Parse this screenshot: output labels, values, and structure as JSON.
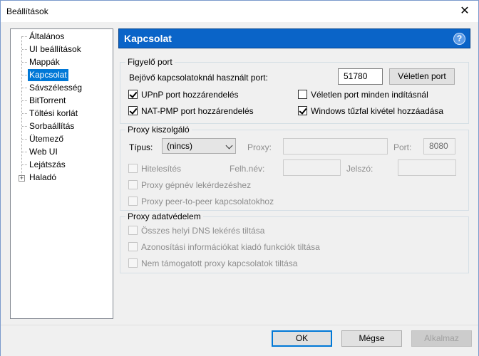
{
  "window": {
    "title": "Beállítások",
    "close_glyph": "✕"
  },
  "sidebar": {
    "items": [
      {
        "label": "Általános"
      },
      {
        "label": "UI beállítások"
      },
      {
        "label": "Mappák"
      },
      {
        "label": "Kapcsolat",
        "selected": true
      },
      {
        "label": "Sávszélesség"
      },
      {
        "label": "BitTorrent"
      },
      {
        "label": "Töltési korlát"
      },
      {
        "label": "Sorbaállítás"
      },
      {
        "label": "Ütemező"
      },
      {
        "label": "Web UI"
      },
      {
        "label": "Lejátszás"
      },
      {
        "label": "Haladó",
        "expander": "+"
      }
    ]
  },
  "panel": {
    "title": "Kapcsolat",
    "help_glyph": "?"
  },
  "listening_port": {
    "group_label": "Figyelő port",
    "port_label": "Bejövő kapcsolatoknál használt port:",
    "port_value": "51780",
    "random_button": "Véletlen port",
    "upnp": {
      "label": "UPnP port hozzárendelés",
      "checked": true
    },
    "random_each_start": {
      "label": "Véletlen port minden indításnál",
      "checked": false
    },
    "natpmp": {
      "label": "NAT-PMP port hozzárendelés",
      "checked": true
    },
    "firewall": {
      "label": "Windows tűzfal kivétel hozzáadása",
      "checked": true
    }
  },
  "proxy_server": {
    "group_label": "Proxy kiszolgáló",
    "type_label": "Típus:",
    "type_value": "(nincs)",
    "proxy_label": "Proxy:",
    "proxy_value": "",
    "port_label": "Port:",
    "port_value": "8080",
    "auth": {
      "label": "Hitelesítés",
      "checked": false
    },
    "username_label": "Felh.név:",
    "username_value": "",
    "password_label": "Jelszó:",
    "password_value": "",
    "hostname_lookup": {
      "label": "Proxy gépnév lekérdezéshez",
      "checked": false
    },
    "p2p": {
      "label": "Proxy peer-to-peer kapcsolatokhoz",
      "checked": false
    }
  },
  "proxy_privacy": {
    "group_label": "Proxy adatvédelem",
    "dns": {
      "label": "Összes helyi DNS lekérés tiltása",
      "checked": false
    },
    "identifying": {
      "label": "Azonosítási információkat kiadó funkciók tiltása",
      "checked": false
    },
    "unsupported": {
      "label": "Nem támogatott proxy kapcsolatok tiltása",
      "checked": false
    }
  },
  "footer": {
    "ok": "OK",
    "cancel": "Mégse",
    "apply": "Alkalmaz"
  }
}
